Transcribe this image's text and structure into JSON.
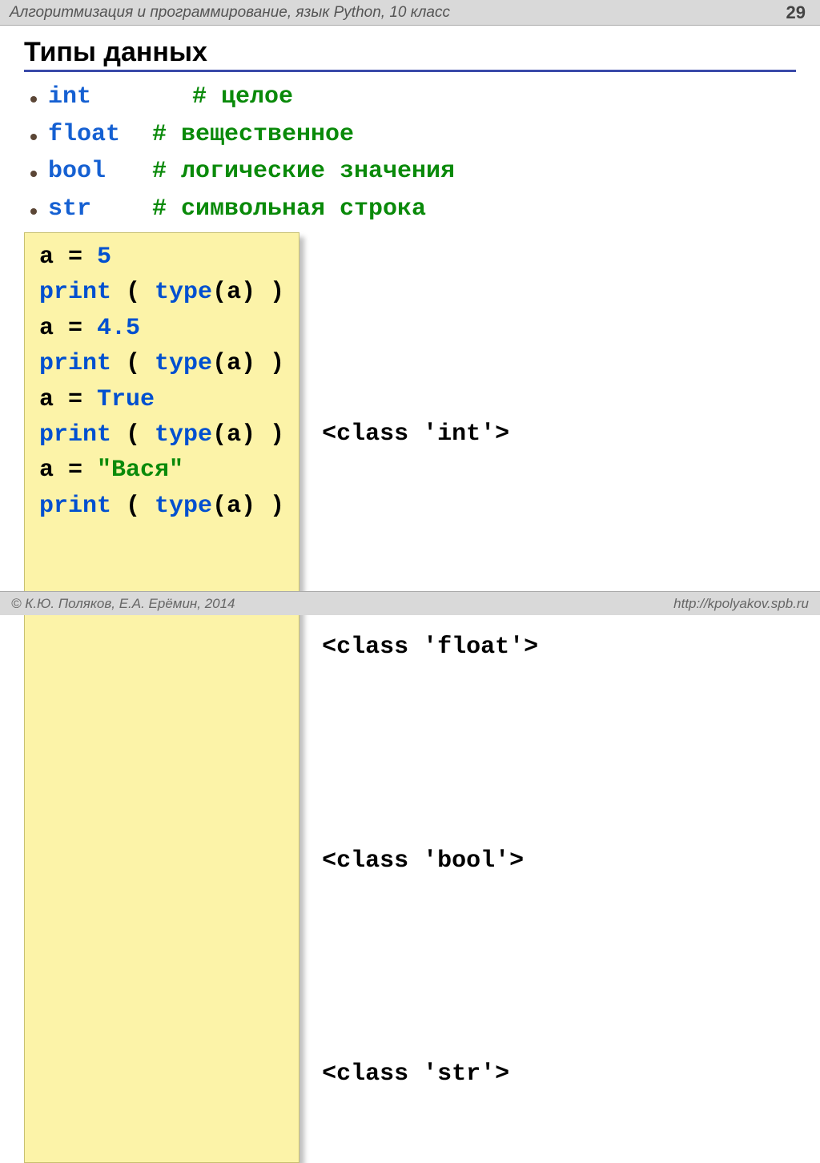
{
  "header": {
    "title": "Алгоритмизация и программирование, язык Python, 10 класс",
    "page": "29"
  },
  "slide_title": "Типы данных",
  "types": {
    "int": {
      "name": "int",
      "comment": "# целое"
    },
    "float": {
      "name": "float",
      "comment": "# вещественное"
    },
    "bool": {
      "name": "bool",
      "comment": "# логические значения"
    },
    "str": {
      "name": "str",
      "comment": "# символьная строка"
    }
  },
  "code": {
    "l1a": "a = ",
    "l1b": "5",
    "l2a": "print ",
    "l2b": "( ",
    "l2c": "type",
    "l2d": "(a) )",
    "l3a": "a = ",
    "l3b": "4.5",
    "l4a": "print ",
    "l4b": "( ",
    "l4c": "type",
    "l4d": "(a) )",
    "l5a": "a = ",
    "l5b": "True",
    "l6a": "print ",
    "l6b": "( ",
    "l6c": "type",
    "l6d": "(a) )",
    "l7a": "a = ",
    "l7b": "\"Вася\"",
    "l8a": "print ",
    "l8b": "( ",
    "l8c": "type",
    "l8d": "(a) )"
  },
  "outputs": {
    "o1": "<class 'int'>",
    "o2": "<class 'float'>",
    "o3": "<class 'bool'>",
    "o4": "<class 'str'>"
  },
  "footer": {
    "authors": "© К.Ю. Поляков, Е.А. Ерёмин, 2014",
    "url": "http://kpolyakov.spb.ru"
  }
}
